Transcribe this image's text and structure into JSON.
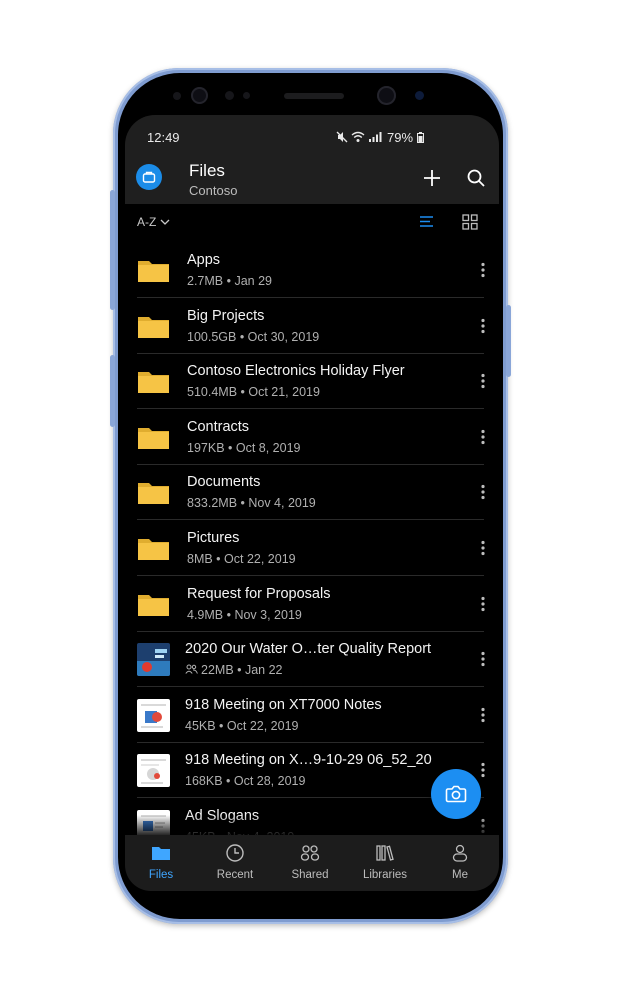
{
  "status": {
    "time": "12:49",
    "battery": "79%",
    "icons": "🔇 ≋ ıll"
  },
  "header": {
    "title": "Files",
    "subtitle": "Contoso"
  },
  "sort": {
    "label": "A-Z"
  },
  "items": [
    {
      "name": "Apps",
      "meta": "2.7MB • Jan 29",
      "kind": "folder"
    },
    {
      "name": "Big Projects",
      "meta": "100.5GB • Oct 30, 2019",
      "kind": "folder"
    },
    {
      "name": "Contoso Electronics Holiday Flyer",
      "meta": "510.4MB • Oct 21, 2019",
      "kind": "folder"
    },
    {
      "name": "Contracts",
      "meta": "197KB • Oct 8, 2019",
      "kind": "folder"
    },
    {
      "name": "Documents",
      "meta": "833.2MB • Nov 4, 2019",
      "kind": "folder"
    },
    {
      "name": "Pictures",
      "meta": "8MB • Oct 22, 2019",
      "kind": "folder"
    },
    {
      "name": "Request for Proposals",
      "meta": "4.9MB • Nov 3, 2019",
      "kind": "folder"
    },
    {
      "name": "2020 Our Water O…ter Quality Report",
      "meta": "22MB • Jan 22",
      "kind": "file-shared"
    },
    {
      "name": "918 Meeting on XT7000 Notes",
      "meta": "45KB • Oct 22, 2019",
      "kind": "file"
    },
    {
      "name": "918 Meeting on X…9-10-29 06_52_20",
      "meta": "168KB • Oct 28, 2019",
      "kind": "file"
    },
    {
      "name": "Ad Slogans",
      "meta": "45KB • Nov 4, 2019",
      "kind": "file"
    }
  ],
  "nav": [
    {
      "label": "Files",
      "active": true
    },
    {
      "label": "Recent",
      "active": false
    },
    {
      "label": "Shared",
      "active": false
    },
    {
      "label": "Libraries",
      "active": false
    },
    {
      "label": "Me",
      "active": false
    }
  ],
  "colors": {
    "accent": "#1c8ef2",
    "folder": "#f6c445",
    "background": "#000000",
    "bar": "#1f1f1f"
  }
}
